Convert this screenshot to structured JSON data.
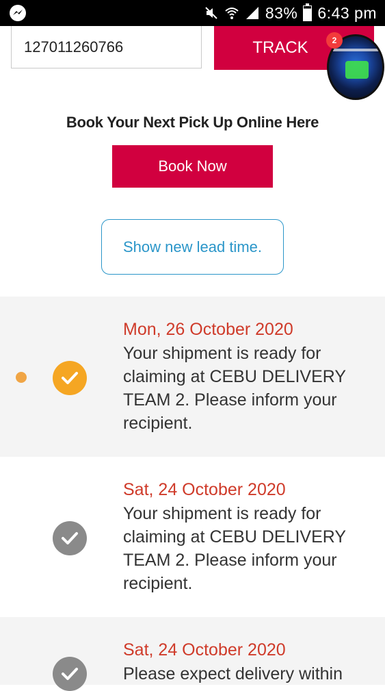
{
  "status_bar": {
    "battery": "83%",
    "time": "6:43 pm",
    "icons": [
      "messenger-icon",
      "mute-icon",
      "wifi-icon",
      "signal-icon",
      "battery-icon"
    ]
  },
  "tracking": {
    "number": "127011260766",
    "track_label": "TRACK"
  },
  "chat_head": {
    "badge_count": "2"
  },
  "booking": {
    "title": "Book Your Next Pick Up Online Here",
    "book_label": "Book Now",
    "lead_time_label": "Show new lead time."
  },
  "events": [
    {
      "date": "Mon, 26 October 2020",
      "line1": "Your shipment is ready for",
      "line2": "claiming at CEBU DELIVERY",
      "line3": "TEAM 2. Please inform your",
      "line4": "recipient.",
      "status": "current"
    },
    {
      "date": "Sat, 24 October 2020",
      "line1": "Your shipment is ready for",
      "line2": "claiming at CEBU DELIVERY",
      "line3": "TEAM 2. Please inform your",
      "line4": "recipient.",
      "status": "past"
    },
    {
      "date": "Sat, 24 October 2020",
      "line1": "Please expect delivery within",
      "status": "past"
    }
  ],
  "colors": {
    "brand_red": "#d1003f",
    "date_red": "#cf3b2a",
    "link_blue": "#2b96c9",
    "check_orange": "#f5a623",
    "check_grey": "#8a8a8a"
  }
}
